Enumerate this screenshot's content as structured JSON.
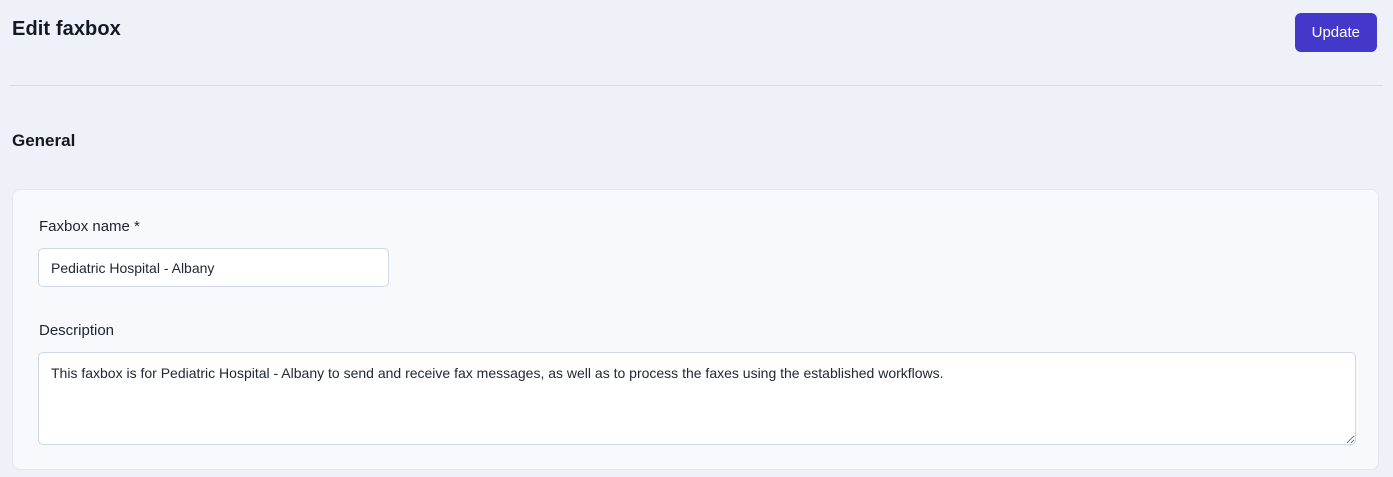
{
  "header": {
    "title": "Edit faxbox",
    "update_button_label": "Update"
  },
  "section": {
    "title": "General"
  },
  "form": {
    "faxbox_name": {
      "label": "Faxbox name *",
      "value": "Pediatric Hospital - Albany"
    },
    "description": {
      "label": "Description",
      "value": "This faxbox is for Pediatric Hospital - Albany to send and receive fax messages, as well as to process the faxes using the established workflows."
    }
  },
  "colors": {
    "accent": "#4338ca",
    "page_background": "#eef1f7",
    "card_background": "#f8f9fc",
    "divider": "#d6dce6",
    "input_border": "#ccd8e4"
  }
}
